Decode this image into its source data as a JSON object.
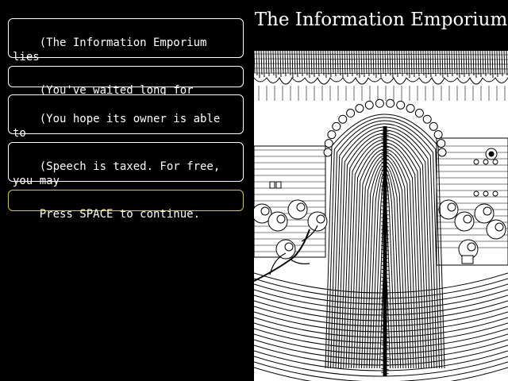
{
  "game": {
    "title": "The Information Emporium"
  },
  "messages": [
    {
      "text": "(The Information Emporium lies\nahead.)"
    },
    {
      "text": "(You've waited long for this.)"
    },
    {
      "text": "(You hope its owner is able to\nrelay a wish.)"
    },
    {
      "text": "(Speech is taxed. For free, you may\nspeak ten words.)"
    }
  ],
  "prompt": {
    "text": "Press SPACE to continue."
  },
  "colors": {
    "background": "#000000",
    "text": "#ffffff",
    "prompt_border": "#d8d000",
    "illustration_bg": "#ffffff",
    "ink": "#000000"
  },
  "illustration": {
    "subject": "tall-ribbed-building-ink-drawing"
  }
}
